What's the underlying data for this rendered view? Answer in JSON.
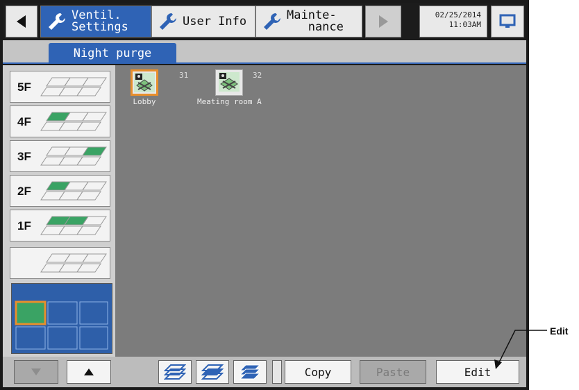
{
  "header": {
    "tabs": [
      {
        "label": "Ventil.\nSettings",
        "icon": "wrench-icon",
        "active": true
      },
      {
        "label": "User Info",
        "icon": "wrench-icon",
        "active": false
      },
      {
        "label": "Mainte-\n   nance",
        "icon": "wrench-icon",
        "active": false
      }
    ],
    "date": "02/25/2014",
    "time": "11:03AM"
  },
  "subtab": {
    "label": "Night purge"
  },
  "floors": [
    {
      "label": "5F"
    },
    {
      "label": "4F"
    },
    {
      "label": "3F"
    },
    {
      "label": "2F"
    },
    {
      "label": "1F"
    },
    {
      "label": ""
    }
  ],
  "units": [
    {
      "number": "31",
      "name": "Lobby",
      "selected": true
    },
    {
      "number": "32",
      "name": "Meating room A",
      "selected": false
    }
  ],
  "toolbar": {
    "copy_label": "Copy",
    "paste_label": "Paste",
    "edit_label": "Edit"
  },
  "callout": {
    "label": "Edit"
  },
  "colors": {
    "active_tab": "#2f63b5",
    "selection": "#e88f2c",
    "floor_fill": "#3aa364"
  }
}
